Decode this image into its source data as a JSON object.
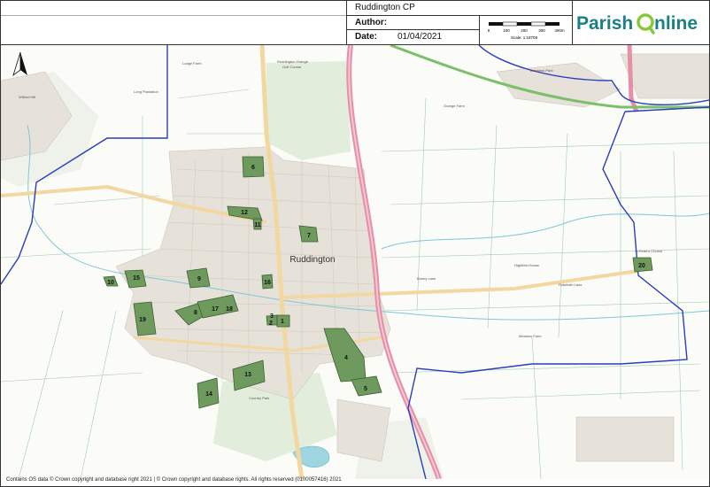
{
  "header": {
    "title": "Ruddington CP",
    "author_label": "Author:",
    "date_label": "Date:",
    "date_value": "01/04/2021",
    "scale_ticks": [
      "0",
      "100",
      "200",
      "300",
      "400m"
    ],
    "scale_text": "Scale: 1:18709"
  },
  "logo": {
    "word1": "Parish",
    "word2": "nline",
    "colors": {
      "teal": "#1a7f86",
      "green": "#8cc63f"
    }
  },
  "map": {
    "town_label": "Ruddington",
    "colors": {
      "site_fill": "#6f9a5e",
      "site_stroke": "#3b5e2f",
      "parish_boundary": "#2b3fb8",
      "main_road": "#e58fa8",
      "minor_road": "#f2d7a0",
      "water": "#7fc7d4",
      "green_area": "#dcebd4"
    },
    "sites": [
      "1",
      "2",
      "3",
      "4",
      "5",
      "6",
      "7",
      "8",
      "9",
      "10",
      "11",
      "12",
      "13",
      "14",
      "15",
      "16",
      "17",
      "18",
      "19",
      "20"
    ],
    "small_labels": [
      "Long Plantation",
      "Golf Course",
      "Wilford Hill",
      "Ruddington Grange",
      "Lodge Farm",
      "Bunny Lane",
      "Flawforth Lane",
      "St Peter's Church",
      "Country Park",
      "Business Park",
      "Highfield House",
      "Grange Farm",
      "Meadow Farm"
    ]
  },
  "footer": {
    "copyright": "Contains OS data © Crown copyright and database right 2021 | © Crown copyright and database rights. All rights reserved (0100057416) 2021"
  }
}
